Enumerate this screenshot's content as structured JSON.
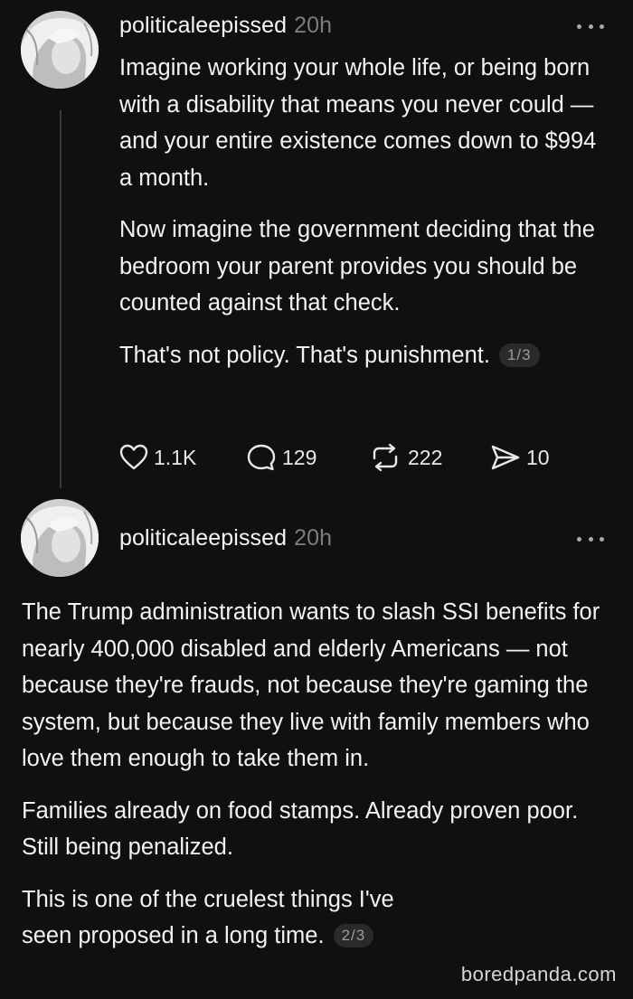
{
  "posts": [
    {
      "username": "politicaleepissed",
      "time": "20h",
      "paragraphs": [
        "Imagine working your whole life, or being born with a disability that means you never could — and your entire existence comes down to $994 a month.",
        "Now imagine the government deciding that the bedroom your parent provides you should be counted against that check."
      ],
      "last_paragraph": "That's not policy. That's punishment.",
      "pager": "1/3",
      "actions": {
        "likes": "1.1K",
        "replies": "129",
        "reposts": "222",
        "shares": "10"
      }
    },
    {
      "username": "politicaleepissed",
      "time": "20h",
      "paragraphs": [
        "The Trump administration wants to slash SSI benefits for nearly 400,000 disabled and elderly Americans — not because they're frauds, not because they're gaming the system, but because they live with family members who love them enough to take them in.",
        "Families already on food stamps. Already proven poor. Still being penalized."
      ],
      "last_paragraph": "This is one of the cruelest things I've seen proposed in a long time.",
      "pager": "2/3"
    }
  ],
  "watermark": "boredpanda.com",
  "icons": {
    "like": "heart-icon",
    "reply": "comment-icon",
    "repost": "repost-icon",
    "share": "send-icon",
    "more": "more-dots-icon"
  },
  "colors": {
    "background": "#101010",
    "text": "#f3f3f3",
    "muted": "#7d7d7d"
  }
}
